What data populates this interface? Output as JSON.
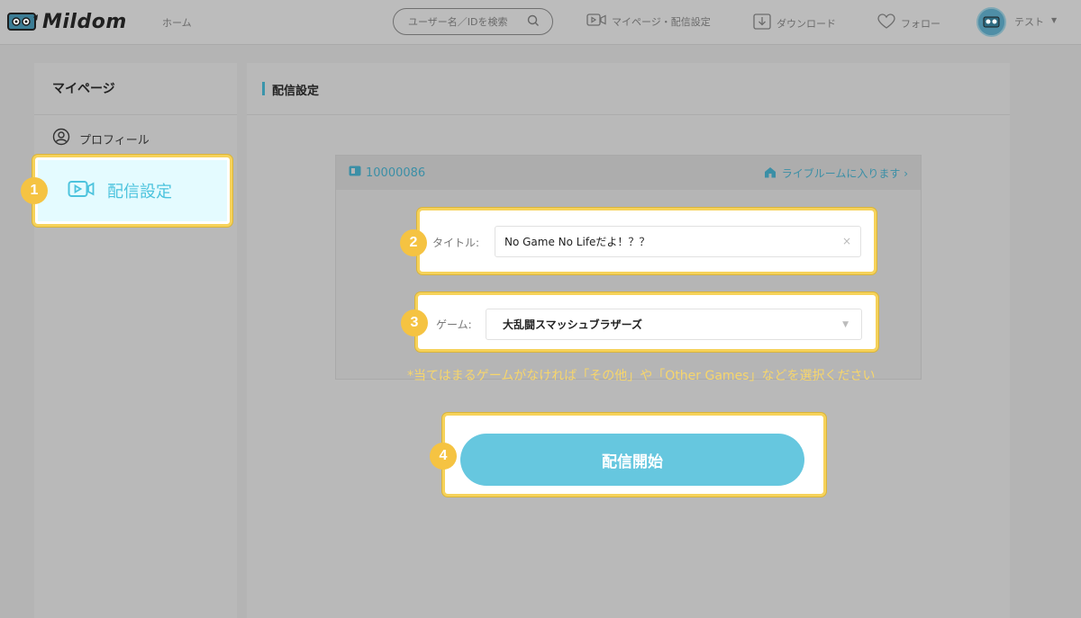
{
  "header": {
    "logo_text": "Mildom",
    "home_label": "ホーム",
    "search_placeholder": "ユーザー名／IDを検索",
    "mypage_label": "マイページ・配信設定",
    "download_label": "ダウンロード",
    "follow_label": "フォロー",
    "user_name": "テスト",
    "user_caret": "▼"
  },
  "sidebar": {
    "title": "マイページ",
    "profile_label": "プロフィール",
    "stream_settings_label": "配信設定"
  },
  "main": {
    "page_title": "配信設定",
    "room_id": "10000086",
    "room_link": "ライブルームに入ります ›",
    "title_label": "タイトル:",
    "title_value": "No Game No Lifeだよ！？？",
    "clear_icon": "×",
    "game_label": "ゲーム:",
    "game_value": "大乱闘スマッシュブラザーズ",
    "game_caret": "▼",
    "note": "*当てはまるゲームがなければ「その他」や「Other Games」などを選択ください",
    "start_button": "配信開始"
  },
  "badges": {
    "b1": "1",
    "b2": "2",
    "b3": "3",
    "b4": "4"
  },
  "colors": {
    "accent": "#66c7df",
    "highlight": "#f6d25a",
    "badge": "#f5c342",
    "link": "#3b8fa6",
    "overlay_bg": "#b4b4b4"
  }
}
